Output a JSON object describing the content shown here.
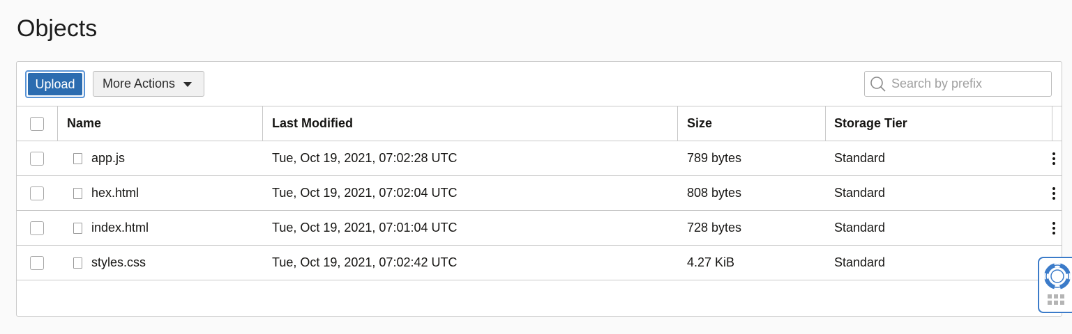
{
  "page": {
    "title": "Objects"
  },
  "toolbar": {
    "upload_label": "Upload",
    "more_actions_label": "More Actions",
    "search_placeholder": "Search by prefix"
  },
  "table": {
    "columns": {
      "name": "Name",
      "last_modified": "Last Modified",
      "size": "Size",
      "storage_tier": "Storage Tier"
    },
    "rows": [
      {
        "name": "app.js",
        "last_modified": "Tue, Oct 19, 2021, 07:02:28 UTC",
        "size": "789 bytes",
        "storage_tier": "Standard",
        "has_actions": true
      },
      {
        "name": "hex.html",
        "last_modified": "Tue, Oct 19, 2021, 07:02:04 UTC",
        "size": "808 bytes",
        "storage_tier": "Standard",
        "has_actions": true
      },
      {
        "name": "index.html",
        "last_modified": "Tue, Oct 19, 2021, 07:01:04 UTC",
        "size": "728 bytes",
        "storage_tier": "Standard",
        "has_actions": true
      },
      {
        "name": "styles.css",
        "last_modified": "Tue, Oct 19, 2021, 07:02:42 UTC",
        "size": "4.27 KiB",
        "storage_tier": "Standard",
        "has_actions": false
      }
    ]
  },
  "icons": {
    "search": "search-icon",
    "file": "file-icon",
    "kebab": "kebab-menu-icon",
    "help": "lifebuoy-icon",
    "caret": "caret-down-icon"
  },
  "colors": {
    "primary_button": "#2b6cb0",
    "focus_ring": "#5a94d6",
    "help_accent": "#3b7bc9"
  }
}
